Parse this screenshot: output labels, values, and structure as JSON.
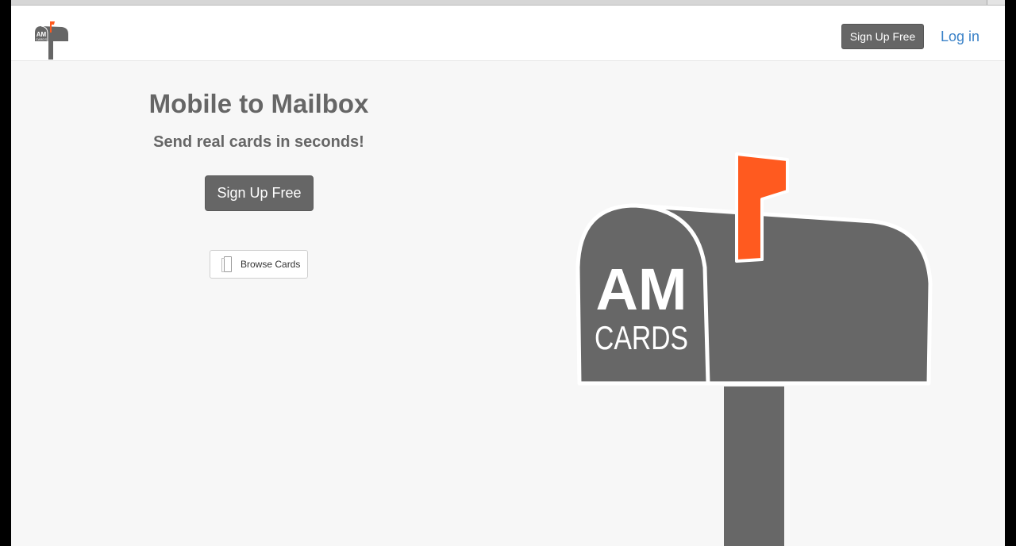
{
  "header": {
    "logo": {
      "top_text": "AM",
      "bottom_text": "CARDS",
      "flag_color": "#ff5a1f"
    },
    "signup_label": "Sign Up Free",
    "login_label": "Log in"
  },
  "hero": {
    "title": "Mobile to Mailbox",
    "subtitle": "Send real cards in seconds!",
    "signup_label": "Sign Up Free",
    "browse_label": "Browse Cards",
    "browse_icon": "card-icon"
  },
  "mailbox": {
    "top_text": "AM",
    "bottom_text": "CARDS",
    "body_color": "#676767",
    "flag_color": "#ff5a1f"
  },
  "colors": {
    "button": "#666666",
    "link": "#3a82c8",
    "background": "#f7f7f7"
  }
}
